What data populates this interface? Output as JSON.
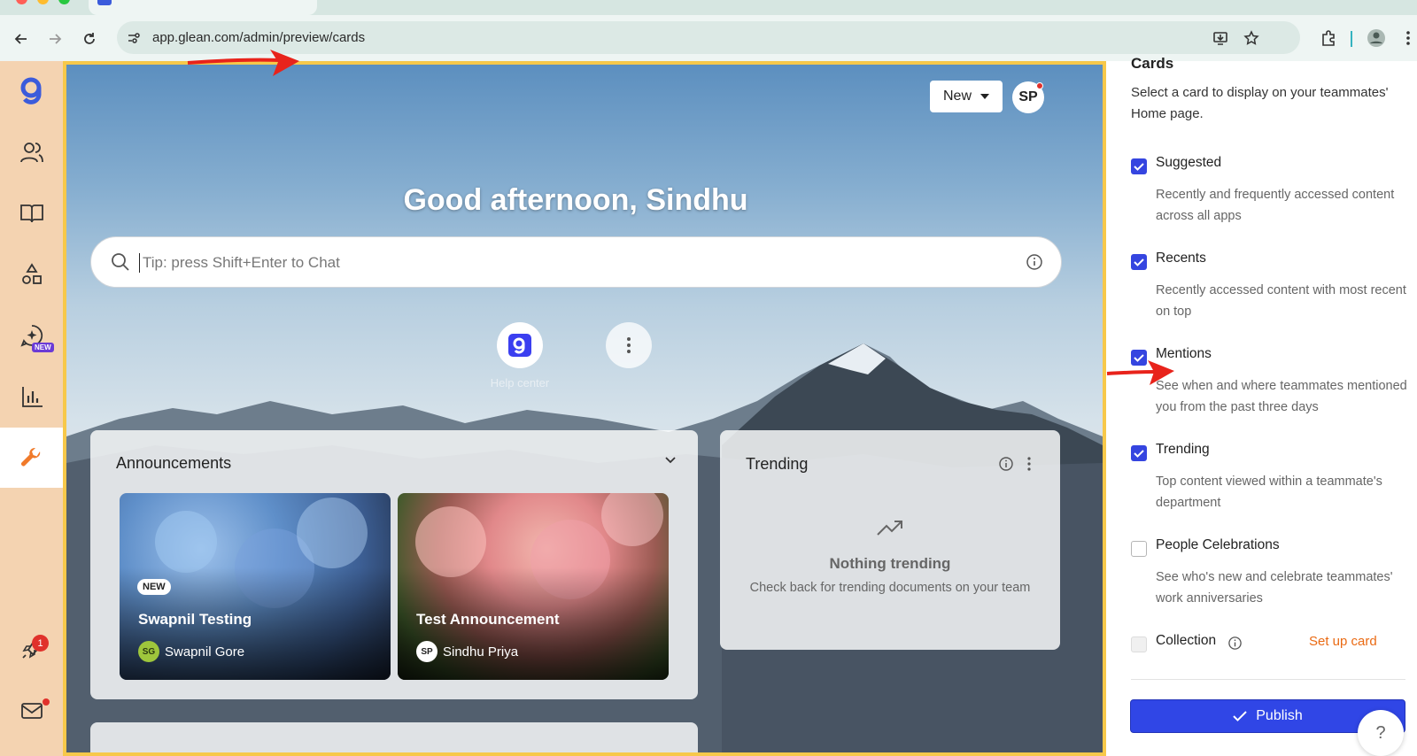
{
  "browser": {
    "url": "app.glean.com/admin/preview/cards"
  },
  "sidebar": {
    "items": [
      {
        "name": "glean-logo"
      },
      {
        "name": "people"
      },
      {
        "name": "knowledge"
      },
      {
        "name": "apps"
      },
      {
        "name": "assistant",
        "badge": "NEW"
      },
      {
        "name": "insights"
      },
      {
        "name": "admin",
        "active": true
      },
      {
        "name": "whats-new",
        "count": "1"
      },
      {
        "name": "inbox"
      }
    ]
  },
  "preview": {
    "new_button": "New",
    "avatar_initials": "SP",
    "greeting": "Good afternoon, Sindhu",
    "search_placeholder": "Tip: press Shift+Enter to Chat",
    "shortcut_label": "Help center",
    "announcements": {
      "title": "Announcements",
      "items": [
        {
          "tag": "NEW",
          "title": "Swapnil Testing",
          "author_initials": "SG",
          "author": "Swapnil Gore"
        },
        {
          "title": "Test Announcement",
          "author_initials": "SP",
          "author": "Sindhu Priya"
        }
      ]
    },
    "trending": {
      "title": "Trending",
      "empty_title": "Nothing trending",
      "empty_hint": "Check back for trending documents on your team"
    }
  },
  "cards_panel": {
    "title": "Cards",
    "description": "Select a card to display on your teammates' Home page.",
    "options": [
      {
        "label": "Suggested",
        "checked": true,
        "description": "Recently and frequently accessed content across all apps"
      },
      {
        "label": "Recents",
        "checked": true,
        "description": "Recently accessed content with most recent on top"
      },
      {
        "label": "Mentions",
        "checked": true,
        "description": "See when and where teammates mentioned you from the past three days"
      },
      {
        "label": "Trending",
        "checked": true,
        "description": "Top content viewed within a teammate's department"
      },
      {
        "label": "People Celebrations",
        "checked": false,
        "description": "See who's new and celebrate teammates' work anniversaries"
      },
      {
        "label": "Collection",
        "checked": false,
        "disabled": true
      }
    ],
    "setup_link": "Set up card",
    "publish_label": "Publish",
    "help_glyph": "?"
  },
  "colors": {
    "accent": "#3545e0",
    "sidebar_bg": "#f4d3b1",
    "preview_border": "#f7c84a",
    "setup_link": "#ea6a13",
    "annotation_arrow": "#e8231b"
  }
}
